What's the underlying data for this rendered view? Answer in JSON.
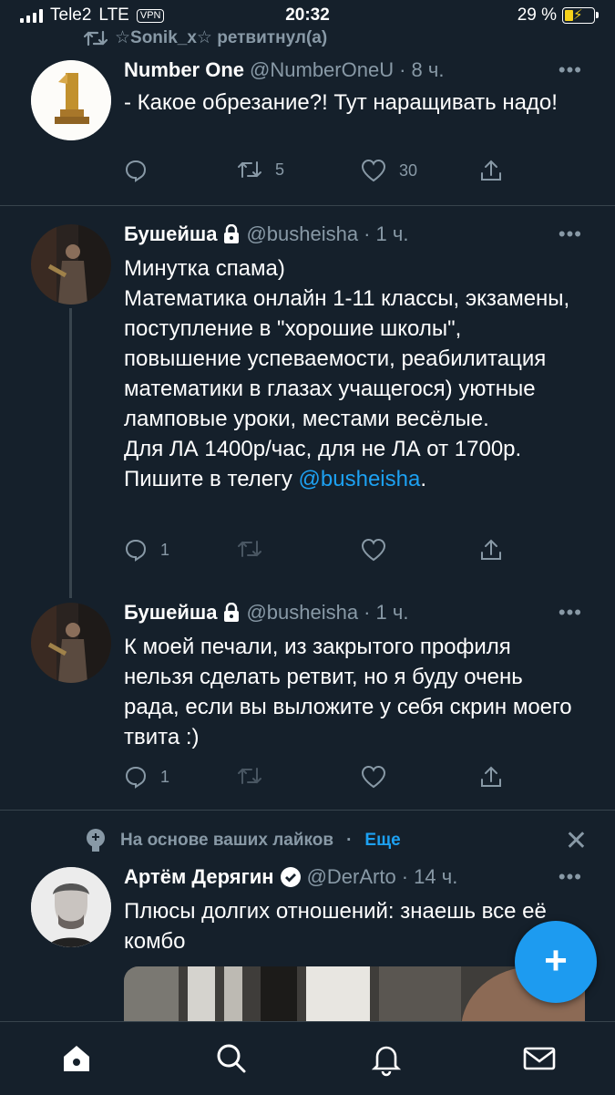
{
  "status_bar": {
    "carrier": "Tele2",
    "network": "LTE",
    "vpn": "VPN",
    "time": "20:32",
    "battery": "29 %"
  },
  "retweet_banner": "☆Sonik_x☆ ретвитнул(а)",
  "tweets": [
    {
      "name": "Number One",
      "handle": "@NumberOneU",
      "time": "· 8 ч.",
      "text": "- Какое обрезание?! Тут наращивать надо!",
      "replies": "",
      "retweets": "5",
      "likes": "30"
    },
    {
      "name": "Бушейша",
      "handle": "@busheisha",
      "time": "· 1 ч.",
      "text_before": "Минутка спама)\nМатематика онлайн 1-11 классы, экзамены, поступление в \"хорошие школы\", повышение успеваемости, реабилитация математики в глазах учащегося) уютные ламповые уроки, местами весёлые.\nДля ЛА 1400р/час, для не ЛА от 1700р.\nПишите в телегу ",
      "mention": "@busheisha",
      "text_after": ".",
      "replies": "1",
      "retweets": "",
      "likes": ""
    },
    {
      "name": "Бушейша",
      "handle": "@busheisha",
      "time": "· 1 ч.",
      "text": "К моей печали, из закрытого профиля нельзя сделать ретвит, но я буду очень рада, если вы выложите у себя скрин моего твита :)",
      "replies": "1",
      "retweets": "",
      "likes": ""
    }
  ],
  "recommendation": {
    "label": "На основе ваших лайков",
    "separator": "·",
    "more": "Еще"
  },
  "promoted_tweet": {
    "name": "Артём Дерягин",
    "handle": "@DerArto",
    "time": "· 14 ч.",
    "text": "Плюсы долгих отношений: знаешь все её комбо"
  },
  "fab_label": "+",
  "tabs": [
    "home-icon",
    "search-icon",
    "notifications-icon",
    "messages-icon"
  ],
  "colors": {
    "background": "#15202b",
    "accent": "#1da1f2",
    "secondary_text": "#8899a6",
    "divider": "#38444d"
  }
}
